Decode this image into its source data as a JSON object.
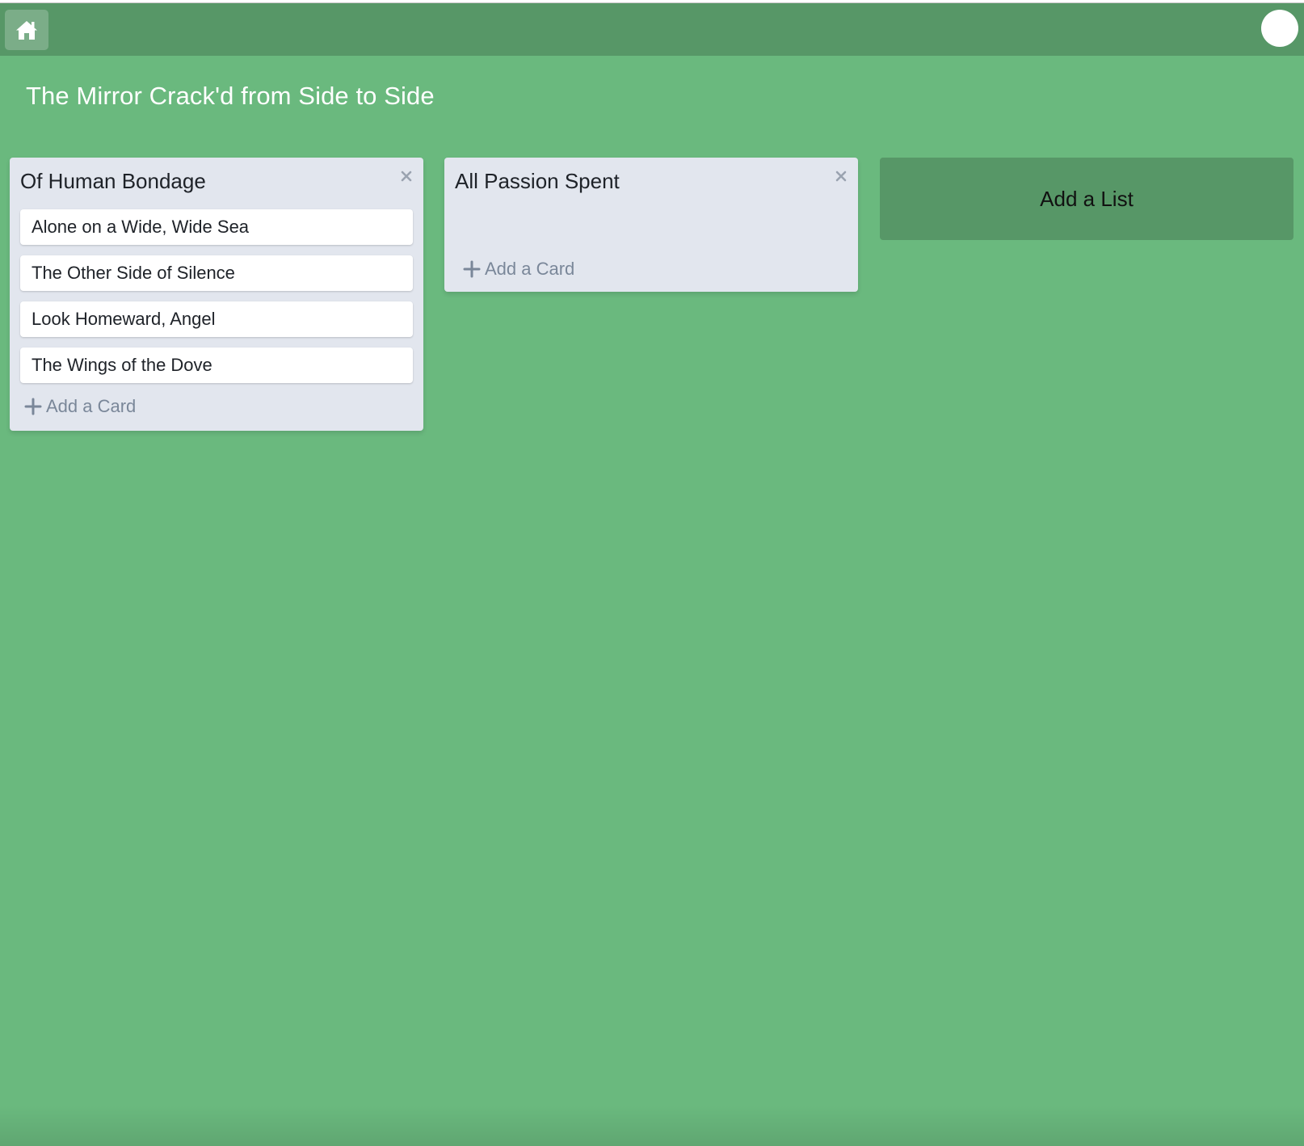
{
  "header": {
    "home_icon": "home-icon",
    "avatar": "user-avatar"
  },
  "board": {
    "title": "The Mirror Crack'd from Side to Side"
  },
  "lists": [
    {
      "title": "Of Human Bondage",
      "cards": [
        "Alone on a Wide, Wide Sea",
        "The Other Side of Silence",
        "Look Homeward, Angel",
        "The Wings of the Dove"
      ],
      "add_card_label": "Add a Card"
    },
    {
      "title": "All Passion Spent",
      "cards": [],
      "add_card_label": "Add a Card"
    }
  ],
  "add_list_label": "Add a List",
  "colors": {
    "board_background": "#6ab97e",
    "topbar": "#579767",
    "list_background": "#e2e6ee",
    "card_background": "#ffffff",
    "add_card_text": "#7a8799"
  }
}
